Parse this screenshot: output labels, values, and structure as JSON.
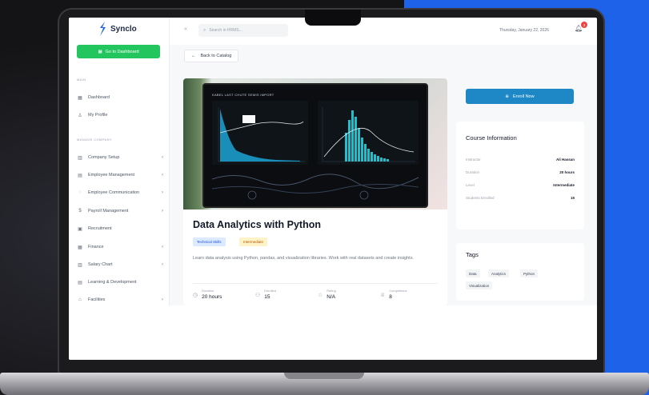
{
  "app": {
    "brand": "Synclo"
  },
  "sidebar": {
    "dashboard_button": "Go to Dashboard",
    "section_main": "MAIN",
    "main_items": [
      {
        "label": "Dashboard",
        "icon": "grid-icon"
      },
      {
        "label": "My Profile",
        "icon": "user-icon"
      }
    ],
    "section_company": "MANAGE COMPANY",
    "company_items": [
      {
        "label": "Company Setup",
        "icon": "building-icon"
      },
      {
        "label": "Employee Management",
        "icon": "people-icon"
      },
      {
        "label": "Employee Communication",
        "icon": "chat-icon"
      },
      {
        "label": "Payroll Management",
        "icon": "payroll-icon"
      },
      {
        "label": "Recruitment",
        "icon": "recruit-icon"
      },
      {
        "label": "Finance",
        "icon": "finance-icon"
      },
      {
        "label": "Salary Chart",
        "icon": "chart-icon"
      },
      {
        "label": "Learning & Development",
        "icon": "learning-icon"
      },
      {
        "label": "Facilities",
        "icon": "home-icon"
      }
    ]
  },
  "header": {
    "search_placeholder": "Search in HRMS...",
    "date": "Thursday, January 22, 2026",
    "notification_count": "3"
  },
  "page": {
    "back_label": "Back to Catalog",
    "hero_caption": "KABEL LAST CHUTE SEMIS IMPORT",
    "course_title": "Data Analytics with Python",
    "category": "Technical Skills",
    "level": "Intermediate",
    "description": "Learn data analysis using Python, pandas, and visualization libraries. Work with real datasets and create insights.",
    "stats": [
      {
        "label": "Duration",
        "value": "20 hours",
        "icon": "clock-icon"
      },
      {
        "label": "Enrolled",
        "value": "15",
        "icon": "users-icon"
      },
      {
        "label": "Rating",
        "value": "N/A",
        "icon": "star-icon"
      },
      {
        "label": "Completions",
        "value": "8",
        "icon": "trophy-icon"
      }
    ],
    "enroll_label": "Enroll Now"
  },
  "course_info": {
    "title": "Course Information",
    "rows": [
      {
        "label": "Instructor",
        "value": "Ali Hassan"
      },
      {
        "label": "Duration",
        "value": "20 hours"
      },
      {
        "label": "Level",
        "value": "Intermediate"
      },
      {
        "label": "Students Enrolled",
        "value": "15"
      }
    ]
  },
  "tags": {
    "title": "Tags",
    "items": [
      "Data",
      "Analytics",
      "Python",
      "Visualization"
    ]
  },
  "colors": {
    "accent_green": "#22c55e",
    "accent_blue": "#1e88c7",
    "backdrop_blue": "#1d62e8",
    "notification_red": "#ef4444"
  }
}
